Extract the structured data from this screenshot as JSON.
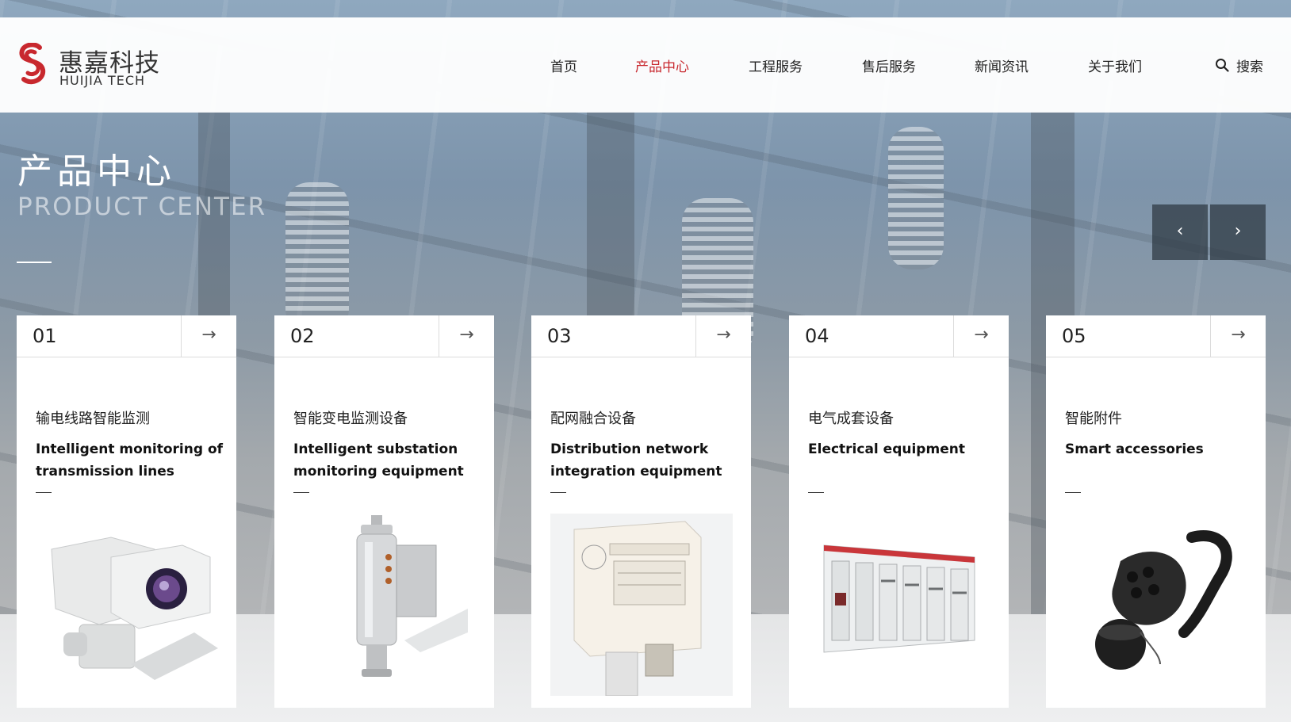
{
  "header": {
    "logo_cn": "惠嘉科技",
    "logo_en": "HUIJIA TECH",
    "nav": [
      {
        "label": "首页",
        "active": false
      },
      {
        "label": "产品中心",
        "active": true
      },
      {
        "label": "工程服务",
        "active": false
      },
      {
        "label": "售后服务",
        "active": false
      },
      {
        "label": "新闻资讯",
        "active": false
      },
      {
        "label": "关于我们",
        "active": false
      }
    ],
    "search_label": "搜索",
    "search_icon": "search-icon"
  },
  "hero": {
    "title": "产品中心",
    "subtitle": "PRODUCT CENTER",
    "prev_label": "‹",
    "next_label": "›"
  },
  "cards": [
    {
      "num": "01",
      "arrow": "→",
      "title_cn": "输电线路智能监测",
      "title_en": "Intelligent monitoring of transmission lines",
      "image": "ptz-camera"
    },
    {
      "num": "02",
      "arrow": "→",
      "title_cn": "智能变电监测设备",
      "title_en": "Intelligent substation monitoring equipment",
      "image": "gas-sensor"
    },
    {
      "num": "03",
      "arrow": "→",
      "title_cn": "配网融合设备",
      "title_en": "Distribution network integration equipment",
      "image": "terminal-unit"
    },
    {
      "num": "04",
      "arrow": "→",
      "title_cn": "电气成套设备",
      "title_en": "Electrical equipment",
      "image": "switchgear"
    },
    {
      "num": "05",
      "arrow": "→",
      "title_cn": "智能附件",
      "title_en": "Smart accessories",
      "image": "charging-connector"
    }
  ],
  "colors": {
    "accent": "#c8282e",
    "header_bg": "#ffffff",
    "arrow_bg": "#2d3741"
  }
}
